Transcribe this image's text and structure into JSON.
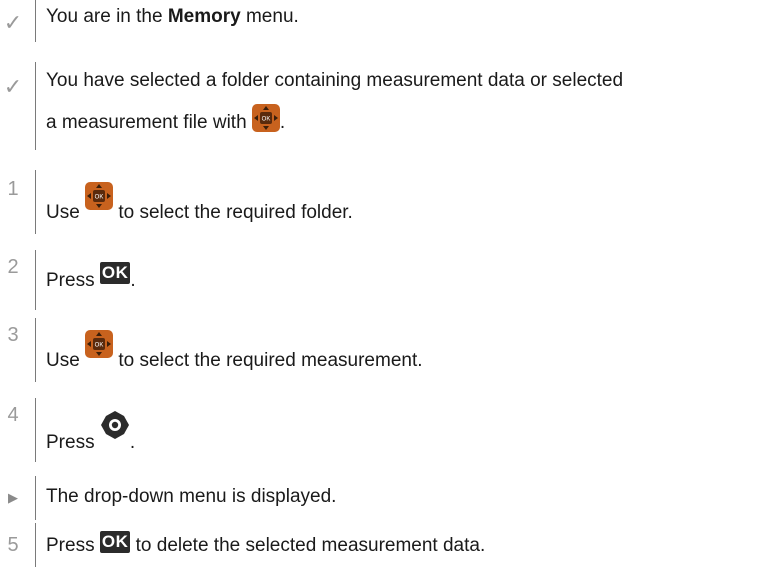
{
  "steps": [
    {
      "marker": "✓",
      "type": "precondition",
      "text_before": "You are in the ",
      "bold": "Memory",
      "text_after": " menu."
    },
    {
      "marker": "✓",
      "type": "precondition",
      "line1": "You have selected a folder containing measurement data or selected",
      "line2_before": "a measurement file with ",
      "line2_after": "."
    },
    {
      "marker": "1",
      "type": "step",
      "text_before": "Use ",
      "text_after": " to select the required folder."
    },
    {
      "marker": "2",
      "type": "step",
      "text_before": "Press ",
      "text_after": "."
    },
    {
      "marker": "3",
      "type": "step",
      "text_before": "Use ",
      "text_after": " to select the required measurement."
    },
    {
      "marker": "4",
      "type": "step",
      "text_before": "Press ",
      "text_after": "."
    },
    {
      "marker": "▶",
      "type": "result",
      "text": "The drop-down menu is displayed."
    },
    {
      "marker": "5",
      "type": "step",
      "text_before": "Press ",
      "text_after": " to delete the selected measurement data."
    }
  ],
  "icons": {
    "ok_label": "OK",
    "joystick_label": "OK",
    "joystick_color": "#c8621e",
    "settings_color": "#2b2b2b"
  }
}
